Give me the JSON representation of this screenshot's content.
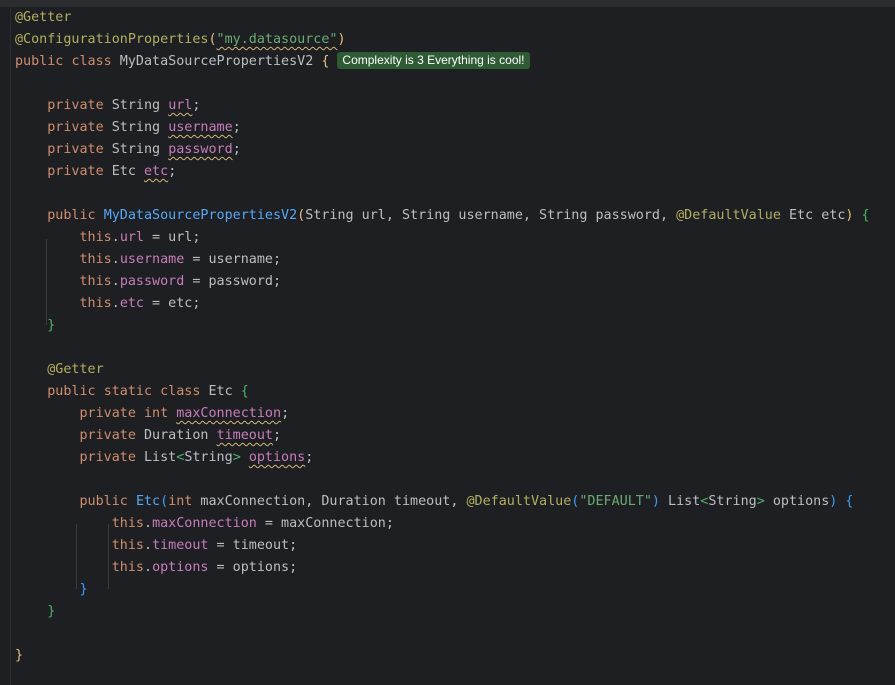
{
  "editor": {
    "hint_badge": "Complexity is 3 Everything is cool!",
    "lines": [
      "@Getter",
      "@ConfigurationProperties(\"my.datasource\")",
      "public class MyDataSourcePropertiesV2 {",
      "",
      "    private String url;",
      "    private String username;",
      "    private String password;",
      "    private Etc etc;",
      "",
      "    public MyDataSourcePropertiesV2(String url, String username, String password, @DefaultValue Etc etc) {",
      "        this.url = url;",
      "        this.username = username;",
      "        this.password = password;",
      "        this.etc = etc;",
      "    }",
      "",
      "    @Getter",
      "    public static class Etc {",
      "        private int maxConnection;",
      "        private Duration timeout;",
      "        private List<String> options;",
      "",
      "        public Etc(int maxConnection, Duration timeout, @DefaultValue(\"DEFAULT\") List<String> options) {",
      "            this.maxConnection = maxConnection;",
      "            this.timeout = timeout;",
      "            this.options = options;",
      "        }",
      "    }",
      "",
      "}"
    ]
  },
  "colors": {
    "background": "#1e1f22",
    "keyword": "#cf8e6d",
    "annotation": "#b3ae60",
    "string": "#6aab73",
    "method": "#56a8f5",
    "field": "#c77dbb",
    "hint_badge_bg": "#2f5b34"
  }
}
